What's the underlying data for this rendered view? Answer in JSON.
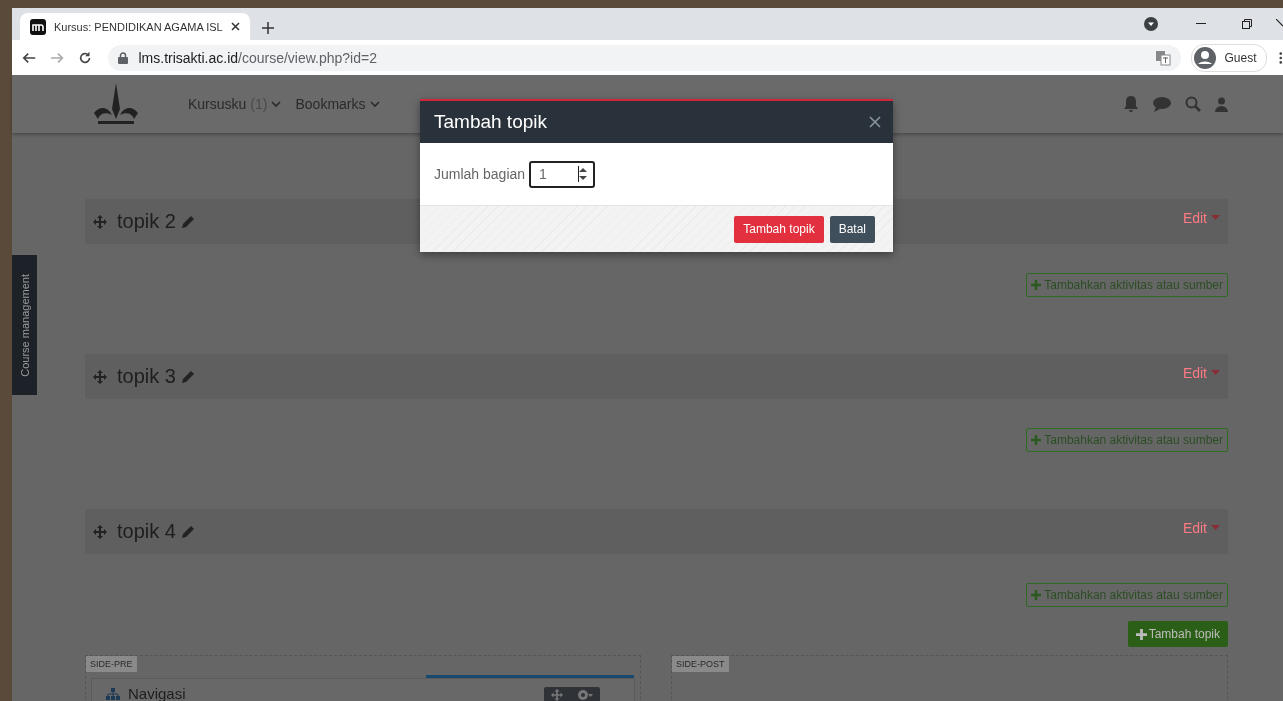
{
  "browser": {
    "tab_title": "Kursus: PENDIDIKAN AGAMA ISL",
    "url_host": "lms.trisakti.ac.id",
    "url_path": "/course/view.php?id=2",
    "profile": "Guest"
  },
  "navbar": {
    "items": [
      {
        "label": "Kursusku",
        "count": "(1)"
      },
      {
        "label": "Bookmarks"
      }
    ]
  },
  "course_management": "Course management",
  "sections": [
    {
      "title": "topik 2",
      "edit": "Edit",
      "add_button": "Tambahkan aktivitas atau sumber"
    },
    {
      "title": "topik 3",
      "edit": "Edit",
      "add_button": "Tambahkan aktivitas atau sumber"
    },
    {
      "title": "topik 4",
      "edit": "Edit",
      "add_button": "Tambahkan aktivitas atau sumber"
    }
  ],
  "add_topic_button": "Tambah topik",
  "side_pre": {
    "label": "SIDE-PRE",
    "block_title": "Navigasi"
  },
  "side_post": {
    "label": "SIDE-POST"
  },
  "modal": {
    "title": "Tambah topik",
    "field_label": "Jumlah bagian",
    "field_value": "1",
    "buttons": [
      {
        "label": "Tambah topik",
        "kind": "primary"
      },
      {
        "label": "Batal",
        "kind": "secondary"
      }
    ]
  }
}
